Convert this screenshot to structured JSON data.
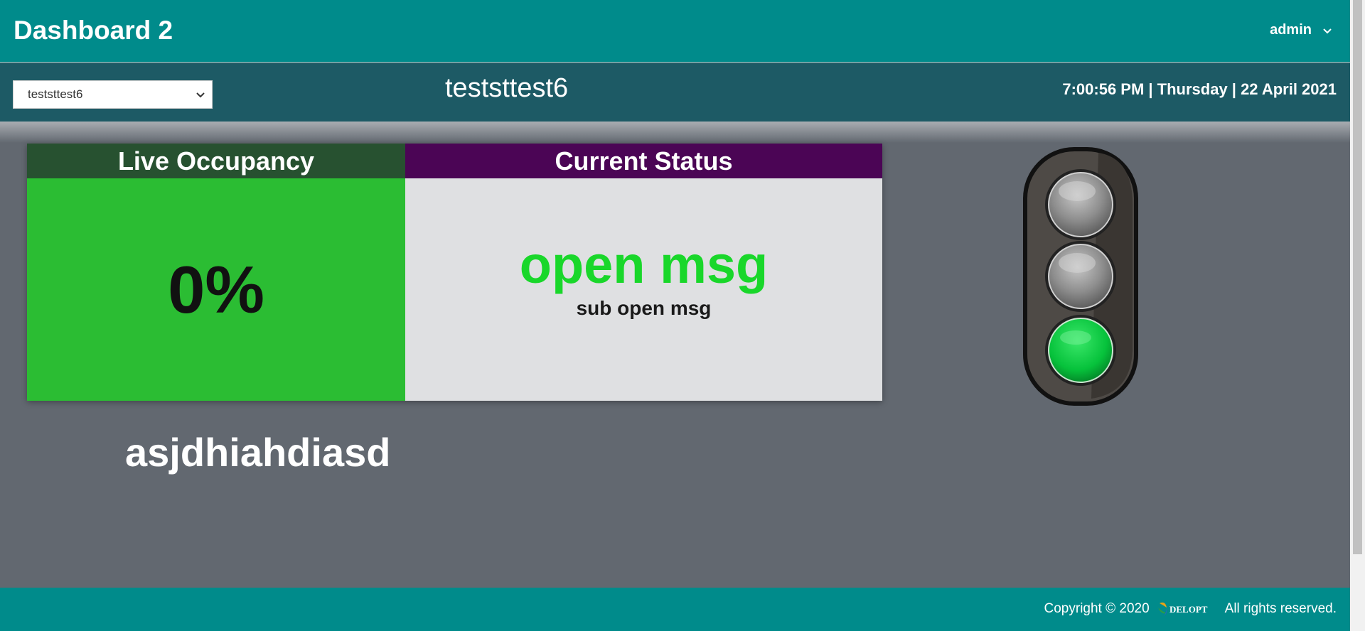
{
  "header": {
    "title": "Dashboard 2",
    "user": "admin"
  },
  "subheader": {
    "selected_site": "teststtest6",
    "site_name": "teststtest6",
    "datetime": "7:00:56 PM | Thursday | 22 April 2021"
  },
  "occupancy": {
    "heading": "Live Occupancy",
    "value": "0%"
  },
  "status": {
    "heading": "Current Status",
    "message": "open msg",
    "sub_message": "sub open msg"
  },
  "free_text": "asjdhiahdiasd",
  "traffic_light": {
    "active": "green"
  },
  "footer": {
    "copyright": "Copyright © 2020",
    "brand": "DELOPT",
    "rights": "All rights reserved."
  },
  "colors": {
    "primary": "#008b8b",
    "subbar": "#1d5a65",
    "occupancy_head": "#275130",
    "occupancy_body": "#2bbd33",
    "status_head": "#4b0555",
    "status_body": "#dfe0e2",
    "status_text": "#19d72a",
    "background": "#626870"
  }
}
